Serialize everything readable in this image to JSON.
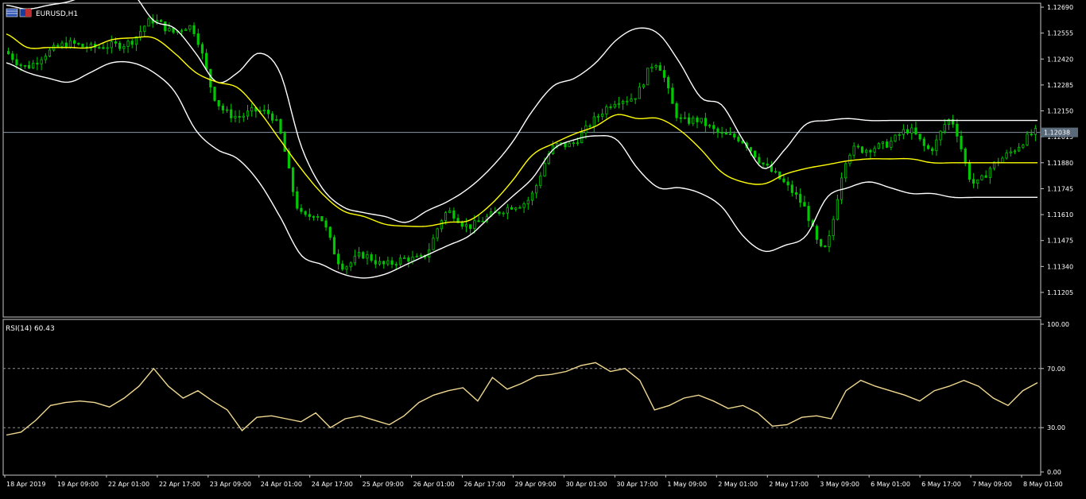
{
  "symbol_label": "EURUSD,H1",
  "colors": {
    "background": "#000000",
    "frame": "#c8c8c8",
    "candle": "#00c800",
    "bollinger": "#ffffff",
    "moving_average": "#ffff00",
    "rsi_line": "#f0d890",
    "current_price_line": "#8899aa",
    "label_text": "#ffffff"
  },
  "icons": [
    "chart-flag-icon",
    "symbol-flag-icon"
  ],
  "chart_data": [
    {
      "type": "line",
      "subtype": "candlestick",
      "title": "EURUSD,H1",
      "xlabel": "",
      "ylabel": "",
      "ylim": [
        1.1107,
        1.12705
      ],
      "price_ticks": [
        "1.12690",
        "1.12555",
        "1.12420",
        "1.12285",
        "1.12150",
        "1.12015",
        "1.11880",
        "1.11745",
        "1.11610",
        "1.11475",
        "1.11340",
        "1.11205"
      ],
      "current_price": "1.12038",
      "x_ticks": [
        "18 Apr 2019",
        "19 Apr 09:00",
        "22 Apr 01:00",
        "22 Apr 17:00",
        "23 Apr 09:00",
        "24 Apr 01:00",
        "24 Apr 17:00",
        "25 Apr 09:00",
        "26 Apr 01:00",
        "26 Apr 17:00",
        "29 Apr 09:00",
        "30 Apr 01:00",
        "30 Apr 17:00",
        "1 May 09:00",
        "2 May 01:00",
        "2 May 17:00",
        "3 May 09:00",
        "6 May 01:00",
        "6 May 17:00",
        "7 May 09:00",
        "8 May 01:00"
      ],
      "grid": false,
      "series": [
        {
          "values": [
            1.1246,
            1.1238,
            1.1245,
            1.125,
            1.1248,
            1.1249,
            1.1251,
            1.1262,
            1.1256,
            1.1257,
            1.1222,
            1.1212,
            1.1215,
            1.1207,
            1.1163,
            1.116,
            1.1135,
            1.114,
            1.1135,
            1.1138,
            1.114,
            1.1162,
            1.1155,
            1.116,
            1.1165,
            1.117,
            1.1195,
            1.1198,
            1.121,
            1.122,
            1.1223,
            1.124,
            1.1212,
            1.121,
            1.1203,
            1.12,
            1.1188,
            1.1178,
            1.1165,
            1.1143,
            1.119,
            1.1195,
            1.1198,
            1.1205,
            1.1195,
            1.121,
            1.1178,
            1.1187,
            1.1195,
            1.1204
          ]
        },
        {
          "name": "MA",
          "values": [
            1.1255,
            1.1248,
            1.1248,
            1.1248,
            1.1248,
            1.1252,
            1.1253,
            1.1253,
            1.1245,
            1.1235,
            1.123,
            1.1227,
            1.1215,
            1.12,
            1.1185,
            1.1172,
            1.1163,
            1.116,
            1.1156,
            1.1155,
            1.1155,
            1.1157,
            1.1158,
            1.1166,
            1.1178,
            1.1192,
            1.1198,
            1.1203,
            1.1207,
            1.1213,
            1.1211,
            1.1211,
            1.1205,
            1.1195,
            1.1183,
            1.1178,
            1.1177,
            1.1182,
            1.1185,
            1.1187,
            1.1189,
            1.119,
            1.119,
            1.119,
            1.1188,
            1.1188,
            1.1188,
            1.1188,
            1.1188,
            1.1188
          ]
        },
        {
          "name": "BB upper",
          "values": [
            1.127,
            1.1268,
            1.127,
            1.1272,
            1.1276,
            1.1278,
            1.1276,
            1.1262,
            1.1258,
            1.1245,
            1.123,
            1.1235,
            1.1245,
            1.1235,
            1.1197,
            1.1175,
            1.1165,
            1.1162,
            1.116,
            1.1157,
            1.1163,
            1.1168,
            1.1175,
            1.1185,
            1.1198,
            1.1215,
            1.1228,
            1.1232,
            1.124,
            1.1252,
            1.1258,
            1.1255,
            1.124,
            1.1222,
            1.1218,
            1.12,
            1.1185,
            1.1195,
            1.1208,
            1.121,
            1.1211,
            1.121,
            1.121,
            1.121,
            1.121,
            1.121,
            1.121,
            1.121,
            1.121,
            1.121
          ]
        },
        {
          "name": "BB lower",
          "values": [
            1.124,
            1.1235,
            1.1232,
            1.123,
            1.1235,
            1.124,
            1.124,
            1.1235,
            1.1225,
            1.1205,
            1.1195,
            1.119,
            1.1178,
            1.116,
            1.114,
            1.1135,
            1.113,
            1.1128,
            1.113,
            1.1135,
            1.114,
            1.1145,
            1.115,
            1.116,
            1.117,
            1.118,
            1.1195,
            1.12,
            1.1202,
            1.12,
            1.1185,
            1.1175,
            1.1175,
            1.1172,
            1.1165,
            1.115,
            1.1142,
            1.1145,
            1.115,
            1.117,
            1.1175,
            1.1178,
            1.1175,
            1.1172,
            1.1172,
            1.117,
            1.117,
            1.117,
            1.117,
            1.117
          ]
        }
      ]
    },
    {
      "type": "line",
      "title": "RSI(14) 60.43",
      "xlabel": "",
      "ylabel": "",
      "ylim": [
        0,
        100
      ],
      "y_ticks": [
        "100.00",
        "70.00",
        "30.00",
        "0.00"
      ],
      "levels": [
        70,
        30
      ],
      "grid": false,
      "series": [
        {
          "name": "RSI(14)",
          "values": [
            25,
            27,
            35,
            45,
            47,
            48,
            47,
            44,
            50,
            58,
            70,
            58,
            50,
            55,
            48,
            42,
            28,
            37,
            38,
            36,
            34,
            40,
            30,
            36,
            38,
            35,
            32,
            38,
            47,
            52,
            55,
            57,
            48,
            64,
            56,
            60,
            65,
            66,
            68,
            72,
            74,
            68,
            70,
            62,
            42,
            45,
            50,
            52,
            48,
            43,
            45,
            40,
            31,
            32,
            37,
            38,
            36,
            55,
            62,
            58,
            55,
            52,
            48,
            55,
            58,
            62,
            58,
            50,
            45,
            55,
            60.43
          ]
        }
      ]
    }
  ]
}
